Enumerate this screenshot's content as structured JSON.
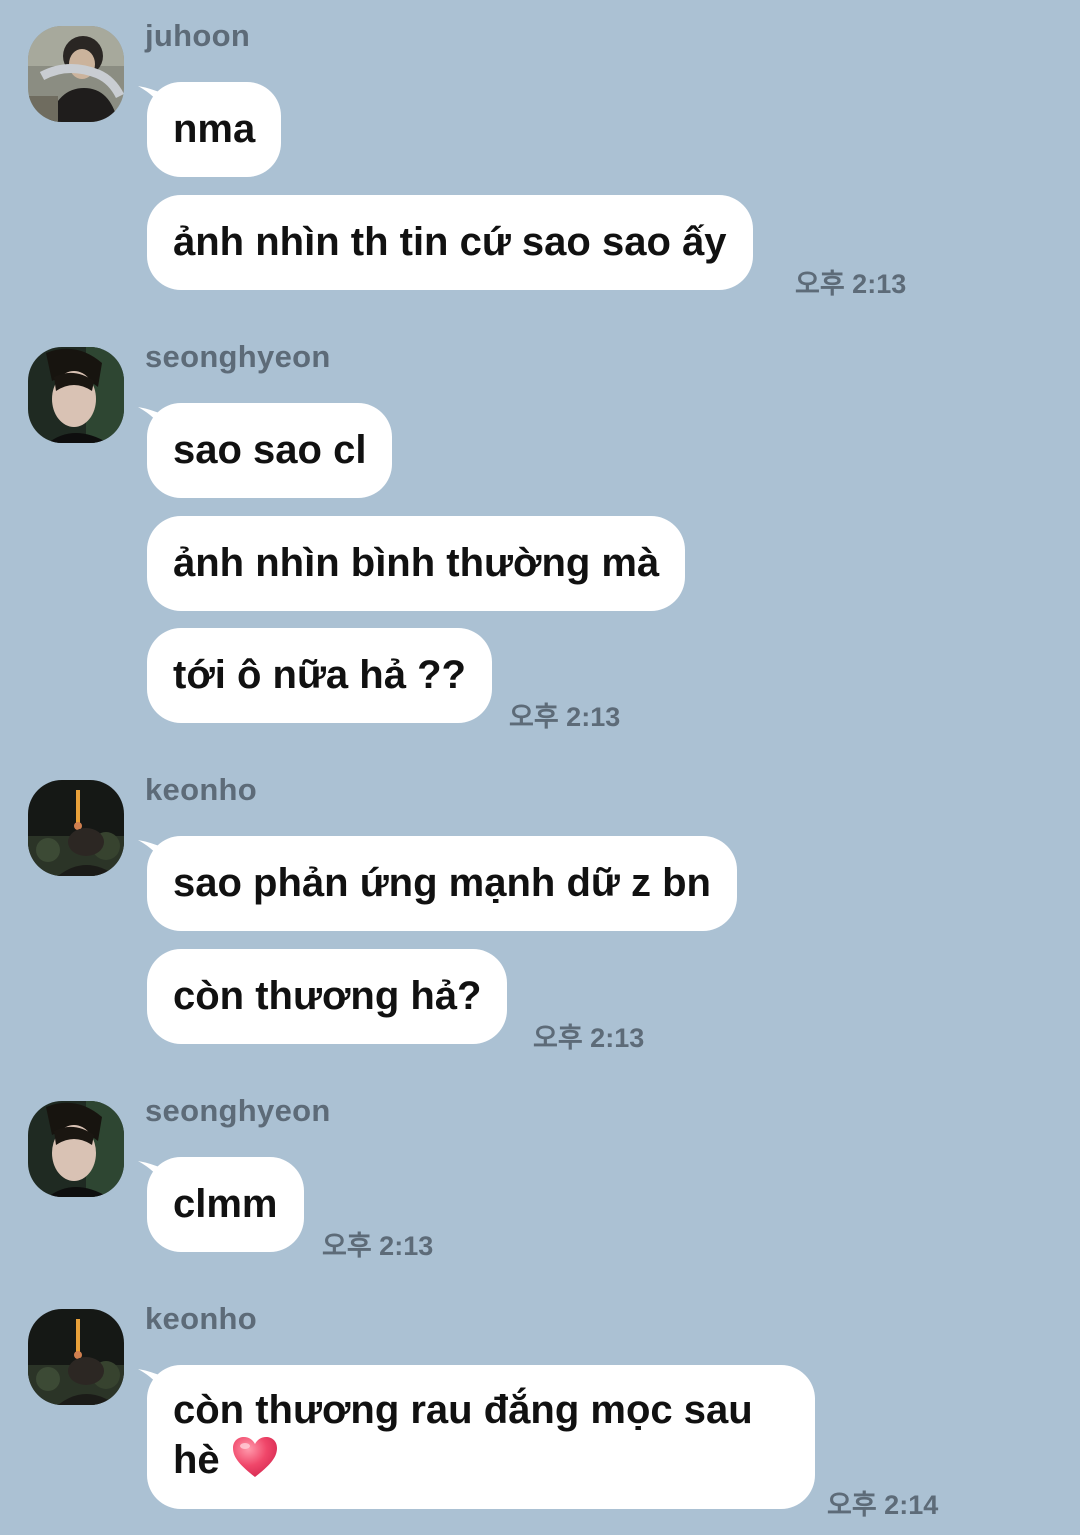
{
  "conversation": [
    {
      "sender": "juhoon",
      "avatar": "profile-photo-juhoon",
      "messages": [
        "nma",
        "ảnh nhìn th tin cứ sao sao ấy"
      ],
      "time": "오후 2:13"
    },
    {
      "sender": "seonghyeon",
      "avatar": "profile-photo-seonghyeon",
      "messages": [
        "sao sao cl",
        "ảnh nhìn bình thường mà",
        "tới ô nữa hả ??"
      ],
      "time": "오후 2:13"
    },
    {
      "sender": "keonho",
      "avatar": "profile-photo-keonho",
      "messages": [
        "sao phản ứng mạnh dữ z bn",
        "còn thương hả?"
      ],
      "time": "오후 2:13"
    },
    {
      "sender": "seonghyeon",
      "avatar": "profile-photo-seonghyeon",
      "messages": [
        "clmm"
      ],
      "time": "오후 2:13"
    },
    {
      "sender": "keonho",
      "avatar": "profile-photo-keonho",
      "messages": [
        "còn thương rau đắng mọc sau hè"
      ],
      "emoji": "heart-emoji",
      "time": "오후 2:14"
    }
  ],
  "colors": {
    "background": "#abc1d3",
    "bubble": "#ffffff",
    "meta_text": "#5d6b78",
    "heart": "#f0476a"
  }
}
